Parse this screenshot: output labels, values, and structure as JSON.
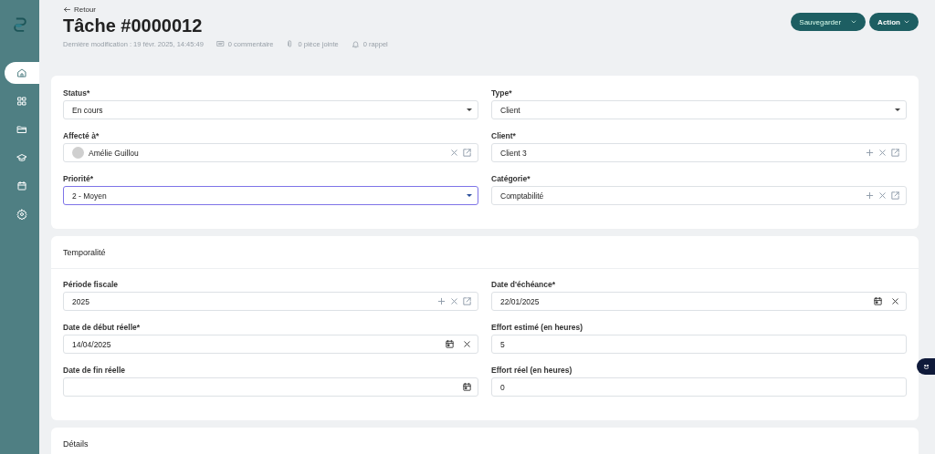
{
  "sidebar": {
    "items": [
      {
        "selected": true
      },
      {
        "selected": false
      },
      {
        "selected": false
      },
      {
        "selected": false
      },
      {
        "selected": false
      },
      {
        "selected": false
      }
    ]
  },
  "header": {
    "back": "Retour",
    "title": "Tâche #0000012",
    "last_modified": "Dernière modification : 19 févr. 2025, 14:45:49",
    "comments": "0 commentaire",
    "attachments": "0 pièce jointe",
    "reminders": "0 rappel",
    "buttons": [
      "Sauvegarder",
      "Action"
    ]
  },
  "sections": [
    {
      "fields": [
        {
          "label": "Status*",
          "value": "En cours",
          "kind": "select",
          "focused": false
        },
        {
          "label": "Type*",
          "value": "Client",
          "kind": "select",
          "focused": false
        },
        {
          "label": "Affecté à*",
          "value": "Amélie Guillou",
          "kind": "person",
          "focused": false
        },
        {
          "label": "Client*",
          "value": "Client 3",
          "kind": "lookup",
          "focused": false
        },
        {
          "label": "Priorité*",
          "value": "2 - Moyen",
          "kind": "select",
          "focused": true
        },
        {
          "label": "Catégorie*",
          "value": "Comptabilité",
          "kind": "lookup",
          "focused": false
        }
      ]
    },
    {
      "title": "Temporalité",
      "fields": [
        {
          "label": "Période fiscale",
          "value": "2025",
          "kind": "lookup",
          "focused": false
        },
        {
          "label": "Date d'échéance*",
          "value": "22/01/2025",
          "kind": "date",
          "focused": false
        },
        {
          "label": "Date de début réelle*",
          "value": "14/04/2025",
          "kind": "date",
          "focused": false
        },
        {
          "label": "Effort estimé (en heures)",
          "value": "5",
          "kind": "text",
          "focused": false
        },
        {
          "label": "Date de fin réelle",
          "kind": "date",
          "focused": false
        },
        {
          "label": "Effort réel (en heures)",
          "value": "0",
          "kind": "text",
          "focused": false
        }
      ]
    },
    {
      "title": "Détails"
    }
  ]
}
